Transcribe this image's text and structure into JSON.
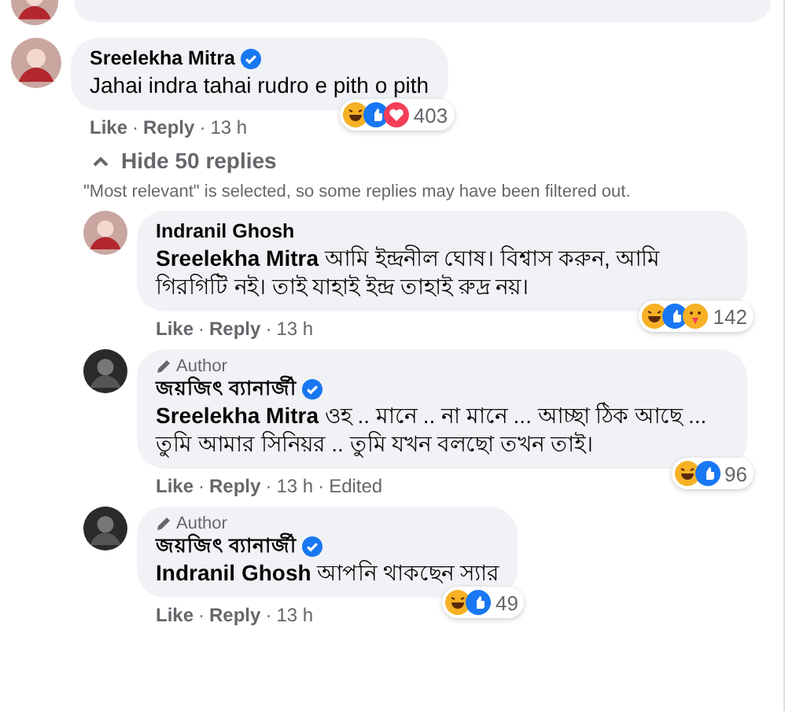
{
  "separator": "·",
  "comment": {
    "author": "Sreelekha Mitra",
    "verified": true,
    "text": "Jahai indra tahai rudro e pith o pith",
    "reactions": [
      {
        "kind": "haha"
      },
      {
        "kind": "like"
      },
      {
        "kind": "love"
      }
    ],
    "reaction_count": "403",
    "actions": [
      {
        "kind": "link",
        "label": "Like"
      },
      {
        "kind": "link",
        "label": "Reply"
      },
      {
        "kind": "meta",
        "label": "13 h"
      }
    ]
  },
  "replies_toggle": {
    "label": "Hide 50 replies",
    "expanded": true
  },
  "filter_note": "\"Most relevant\" is selected, so some replies may have been filtered out.",
  "replies": [
    {
      "author": "Indranil Ghosh",
      "verified": false,
      "text": "**Sreelekha Mitra** আমি ইন্দ্রনীল ঘোষ। বিশ্বাস করুন, আমি গিরগিটি নই। তাই যাহাই ইন্দ্র তাহাই রুদ্র নয়।",
      "reactions": [
        {
          "kind": "haha"
        },
        {
          "kind": "like"
        },
        {
          "kind": "care"
        }
      ],
      "reaction_count": "142",
      "actions": [
        {
          "kind": "link",
          "label": "Like"
        },
        {
          "kind": "link",
          "label": "Reply"
        },
        {
          "kind": "meta",
          "label": "13 h"
        }
      ]
    },
    {
      "author_label": "Author",
      "author": "জয়জিৎ ব্যানার্জী",
      "verified": true,
      "text": "**Sreelekha Mitra** ওহ .. মানে .. না মানে ... আচ্ছা ঠিক আছে ... তুমি আমার সিনিয়র .. তুমি যখন বলছো তখন তাই।",
      "reactions": [
        {
          "kind": "haha"
        },
        {
          "kind": "like"
        }
      ],
      "reaction_count": "96",
      "actions": [
        {
          "kind": "link",
          "label": "Like"
        },
        {
          "kind": "link",
          "label": "Reply"
        },
        {
          "kind": "meta",
          "label": "13 h"
        },
        {
          "kind": "meta",
          "label": "Edited"
        }
      ]
    },
    {
      "author_label": "Author",
      "author": "জয়জিৎ ব্যানার্জী",
      "verified": true,
      "text": "**Indranil Ghosh** আপনি থাকছেন স্যার",
      "reactions": [
        {
          "kind": "haha"
        },
        {
          "kind": "like"
        }
      ],
      "reaction_count": "49",
      "actions": [
        {
          "kind": "link",
          "label": "Like"
        },
        {
          "kind": "link",
          "label": "Reply"
        },
        {
          "kind": "meta",
          "label": "13 h"
        }
      ]
    }
  ]
}
